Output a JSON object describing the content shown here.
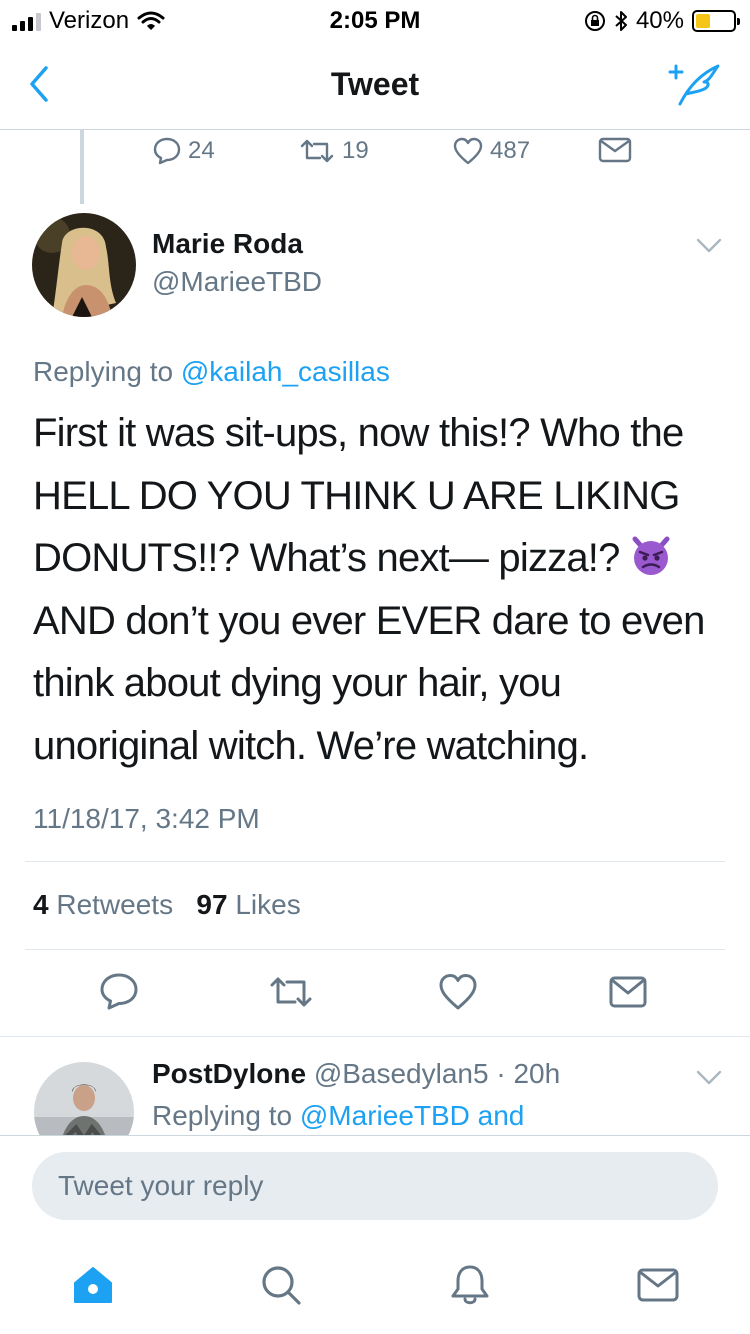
{
  "status_bar": {
    "carrier": "Verizon",
    "time": "2:05 PM",
    "battery": "40%",
    "battery_level": 0.4
  },
  "header": {
    "title": "Tweet",
    "back_icon": "chevron-left-icon",
    "compose_icon": "compose-tweet-icon"
  },
  "previous_tweet_actions": {
    "replies": "24",
    "retweets": "19",
    "likes": "487"
  },
  "tweet": {
    "author_name": "Marie Roda",
    "author_handle": "@MarieeTBD",
    "replying_prefix": "Replying to",
    "replying_to": "@kailah_casillas",
    "text_before_emoji": "First it was sit-ups, now this!? Who the HELL DO YOU THINK U ARE LIKING DONUTS!!? What’s next— pizza!?",
    "emoji": "smiling-imp-emoji",
    "text_after_emoji": "AND don’t you ever EVER dare to even think about dying your hair, you unoriginal witch. We’re watching.",
    "timestamp": "11/18/17, 3:42 PM",
    "retweet_count": "4",
    "retweet_label": "Retweets",
    "like_count": "97",
    "like_label": "Likes"
  },
  "reply_preview": {
    "author_name": "PostDylone",
    "author_handle": "@Basedylan5",
    "separator": "·",
    "age": "20h",
    "replying_prefix": "Replying to",
    "replying_to": "@MarieeTBD and"
  },
  "composer": {
    "placeholder": "Tweet your reply"
  },
  "tab_bar": {
    "tabs": [
      "home-icon",
      "search-icon",
      "notifications-icon",
      "messages-icon"
    ]
  },
  "colors": {
    "accent": "#1da1f2",
    "secondary_text": "#657786",
    "divider": "#e1e8ed"
  }
}
